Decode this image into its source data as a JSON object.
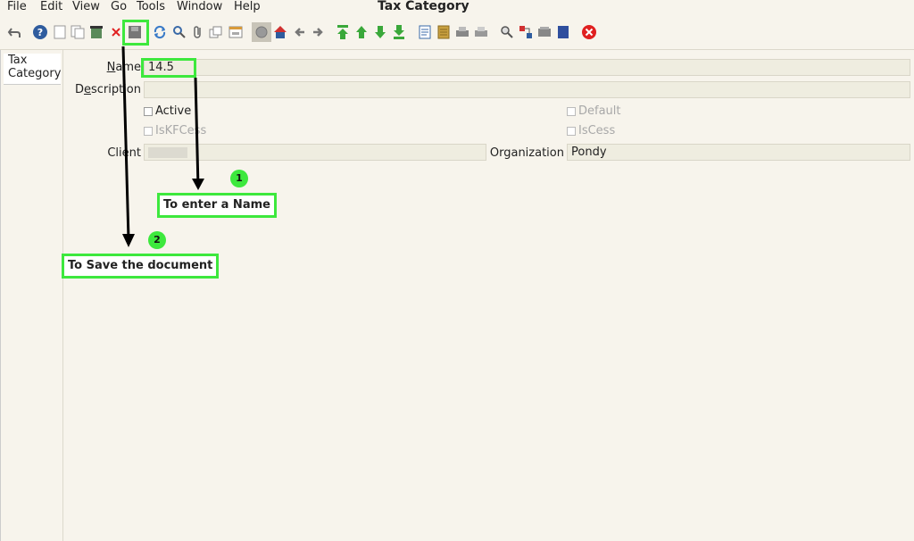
{
  "menu": {
    "file": "File",
    "edit": "Edit",
    "view": "View",
    "go": "Go",
    "tools": "Tools",
    "window": "Window",
    "help": "Help"
  },
  "window_title": "Tax Category",
  "toolbar": {
    "icons": [
      "undo-icon",
      "help-icon",
      "new-icon",
      "copy-icon",
      "delete-record-icon",
      "delete-selection-icon",
      "save-icon",
      "refresh-icon",
      "find-icon",
      "attachment-icon",
      "multi-view-icon",
      "grid-toggle-icon",
      "history-icon",
      "home-icon",
      "previous-icon",
      "next-icon",
      "first-record-icon",
      "parent-icon",
      "detail-icon",
      "last-record-icon",
      "report-icon",
      "archive-icon",
      "print-preview-icon",
      "print-icon",
      "zoom-across-icon",
      "workflow-icon",
      "request-icon",
      "product-info-icon",
      "close-window-icon"
    ]
  },
  "tabs": [
    {
      "label_line1": "Tax",
      "label_line2": "Category"
    }
  ],
  "form": {
    "name_label": "Name",
    "name_value": "14.5",
    "description_label": "Description",
    "description_value": "",
    "active_label": "Active",
    "default_label": "Default",
    "iskfcess_label": "IsKFCess",
    "iscess_label": "IsCess",
    "client_label": "Client",
    "client_value": "",
    "organization_label": "Organization",
    "organization_value": "Pondy"
  },
  "annotations": {
    "step1_number": "1",
    "step1_text": "To enter a Name",
    "step2_number": "2",
    "step2_text": "To Save the document"
  },
  "colors": {
    "highlight": "#3de83d",
    "background": "#f7f4ec",
    "field_bg": "#efede0",
    "delete_red": "#e02020"
  }
}
